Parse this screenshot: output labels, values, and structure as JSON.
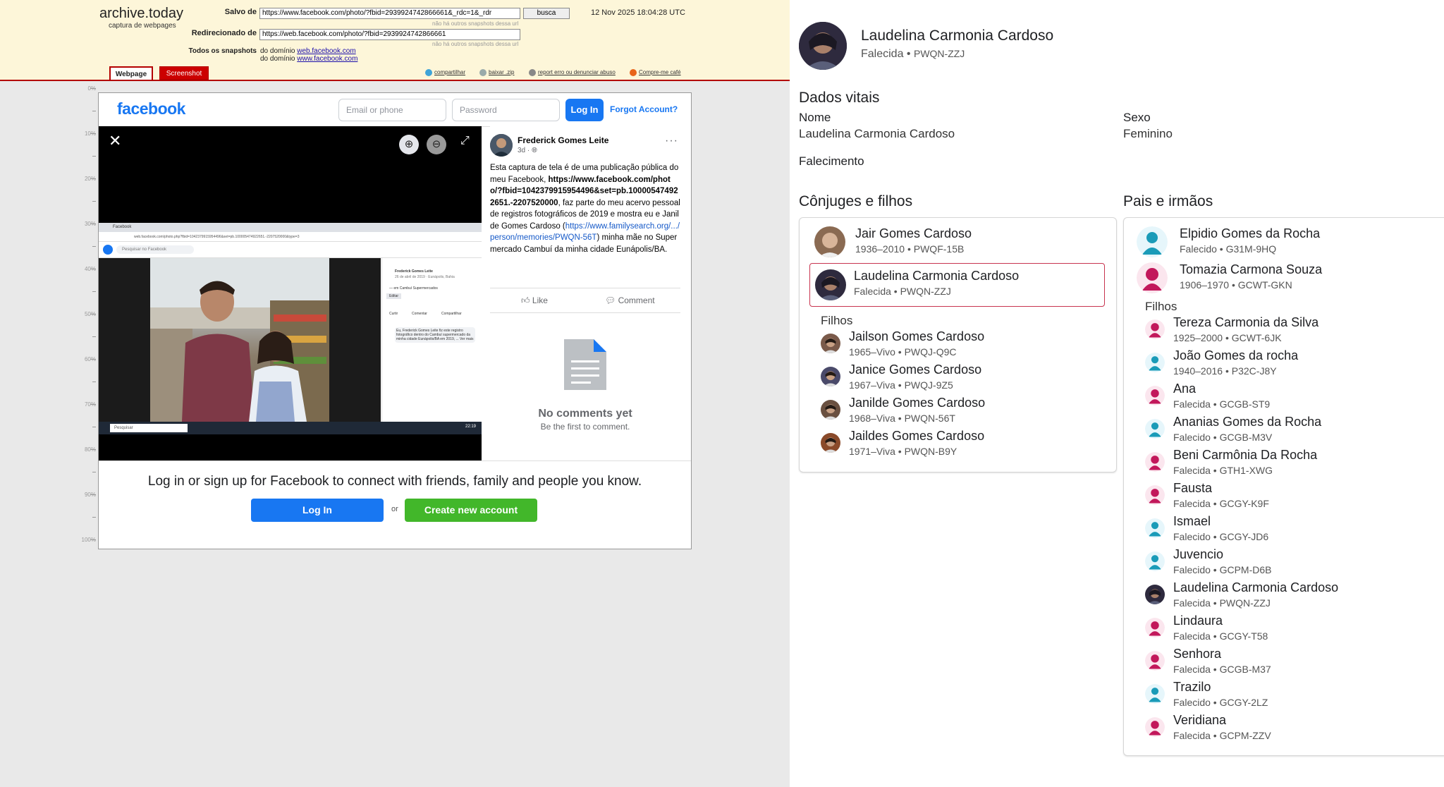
{
  "archive": {
    "logo": "archive.today",
    "tagline": "captura de webpages",
    "saved_label": "Salvo de",
    "saved_url": "https://www.facebook.com/photo/?fbid=2939924742866661&_rdc=1&_rdr",
    "search_button": "busca",
    "date": "12 Nov 2025 18:04:28 UTC",
    "no_other": "não há outros snapshots dessa url",
    "redirected_label": "Redirecionado de",
    "redirected_url": "https://web.facebook.com/photo/?fbid=2939924742866661",
    "all_label": "Todos os snapshots",
    "domain_prefix": "do domínio",
    "domain1": "web.facebook.com",
    "domain2": "www.facebook.com",
    "tab_webpage": "Webpage",
    "tab_screenshot": "Screenshot",
    "act_share": "compartilhar",
    "act_download": "baixar .zip",
    "act_report": "report erro ou denunciar abuso",
    "act_coffee": "Compre-me café",
    "ruler": [
      "0%",
      "10%",
      "20%",
      "30%",
      "40%",
      "50%",
      "60%",
      "70%",
      "80%",
      "90%",
      "100%"
    ]
  },
  "facebook": {
    "logo": "facebook",
    "email_placeholder": "Email or phone",
    "password_placeholder": "Password",
    "login_button": "Log In",
    "forgot": "Forgot Account?",
    "author": "Frederick Gomes Leite",
    "time": "3d ·",
    "more": "···",
    "text_intro": "Esta captura de tela é de uma publicação pública do meu Facebook, ",
    "text_link1": "https://www.facebook.com/photo/?fbid=1042379915954496&set=pb.100005474922651.-2207520000",
    "text_mid": ", faz parte do meu acervo pessoal de registros fotográficos de 2019 e mostra eu e Janilde Gomes Cardoso (",
    "text_link2": "https://www.familysearch.org/.../person/memories/PWQN-56T",
    "text_end": ") minha mãe no Supermercado Cambuí da minha cidade Eunápolis/BA.",
    "like": "Like",
    "comment": "Comment",
    "no_comments": "No comments yet",
    "be_first": "Be the first to comment.",
    "bottom_message": "Log in or sign up for Facebook to connect with friends, family and people you know.",
    "bottom_login": "Log In",
    "or": "or",
    "create_account": "Create new account",
    "inner": {
      "tab": "Facebook",
      "url": "web.facebook.com/photo.php?fbid=1042379915954496&set=pb.100005474922651.-2207520000&type=3",
      "search": "Pesquisar no Facebook",
      "side_name": "Frederick Gomes Leite",
      "side_date": "26 de abril de 2019 · Eunápolis, Bahia",
      "side_place": "— em Cambuí Supermercados",
      "side_edit": "Editar",
      "side_like": "Curtir",
      "side_comment": "Comentar",
      "side_share": "Compartilhar",
      "side_comment_text": "Eu, Frederick Gomes Leite fiz este registro fotográfico dentro do Cambuí supermercado da minha cidade Eunápolis/BA em 2019, ... Ver mais",
      "taskbar_search": "Pesquisar",
      "taskbar_time": "22:19"
    }
  },
  "person": {
    "name": "Laudelina Carmonia Cardoso",
    "status": "Falecida",
    "id": "PWQN-ZZJ",
    "vitals_heading": "Dados vitais",
    "name_label": "Nome",
    "name_value": "Laudelina Carmonia Cardoso",
    "sex_label": "Sexo",
    "sex_value": "Feminino",
    "death_label": "Falecimento"
  },
  "spouses": {
    "heading": "Cônjuges e filhos",
    "spouse1": {
      "name": "Jair Gomes Cardoso",
      "meta": "1936–2010 • PWQF-15B"
    },
    "spouse2": {
      "name": "Laudelina Carmonia Cardoso",
      "meta": "Falecida • PWQN-ZZJ"
    },
    "children_label": "Filhos",
    "children": [
      {
        "name": "Jailson Gomes Cardoso",
        "meta": "1965–Vivo • PWQJ-Q9C"
      },
      {
        "name": "Janice Gomes Cardoso",
        "meta": "1967–Viva • PWQJ-9Z5"
      },
      {
        "name": "Janilde Gomes Cardoso",
        "meta": "1968–Viva • PWQN-56T"
      },
      {
        "name": "Jaildes Gomes Cardoso",
        "meta": "1971–Viva • PWQN-B9Y"
      }
    ]
  },
  "parents": {
    "heading": "Pais e irmãos",
    "father": {
      "name": "Elpidio Gomes da Rocha",
      "meta": "Falecido • G31M-9HQ"
    },
    "mother": {
      "name": "Tomazia Carmona Souza",
      "meta": "1906–1970 • GCWT-GKN"
    },
    "children_label": "Filhos",
    "children": [
      {
        "name": "Tereza Carmonia da Silva",
        "meta": "1925–2000 • GCWT-6JK",
        "sex": "f"
      },
      {
        "name": "João Gomes da rocha",
        "meta": "1940–2016 • P32C-J8Y",
        "sex": "m"
      },
      {
        "name": "Ana",
        "meta": "Falecida • GCGB-ST9",
        "sex": "f"
      },
      {
        "name": "Ananias Gomes da Rocha",
        "meta": "Falecido • GCGB-M3V",
        "sex": "m"
      },
      {
        "name": "Beni Carmônia Da Rocha",
        "meta": "Falecida • GTH1-XWG",
        "sex": "f"
      },
      {
        "name": "Fausta",
        "meta": "Falecida • GCGY-K9F",
        "sex": "f"
      },
      {
        "name": "Ismael",
        "meta": "Falecido • GCGY-JD6",
        "sex": "m"
      },
      {
        "name": "Juvencio",
        "meta": "Falecido • GCPM-D6B",
        "sex": "m"
      },
      {
        "name": "Laudelina Carmonia Cardoso",
        "meta": "Falecida • PWQN-ZZJ",
        "sex": "photo"
      },
      {
        "name": "Lindaura",
        "meta": "Falecida • GCGY-T58",
        "sex": "f"
      },
      {
        "name": "Senhora",
        "meta": "Falecida • GCGB-M37",
        "sex": "f"
      },
      {
        "name": "Trazilo",
        "meta": "Falecido • GCGY-2LZ",
        "sex": "m"
      },
      {
        "name": "Veridiana",
        "meta": "Falecida • GCPM-ZZV",
        "sex": "f"
      }
    ]
  },
  "colors": {
    "facebook_blue": "#1877f2",
    "facebook_green": "#42b72a",
    "archive_red": "#b40000",
    "archive_bg": "#fdf6d9",
    "male_icon": "#1a9bb8",
    "female_icon": "#c2185b",
    "selected_border": "#c8344f"
  }
}
